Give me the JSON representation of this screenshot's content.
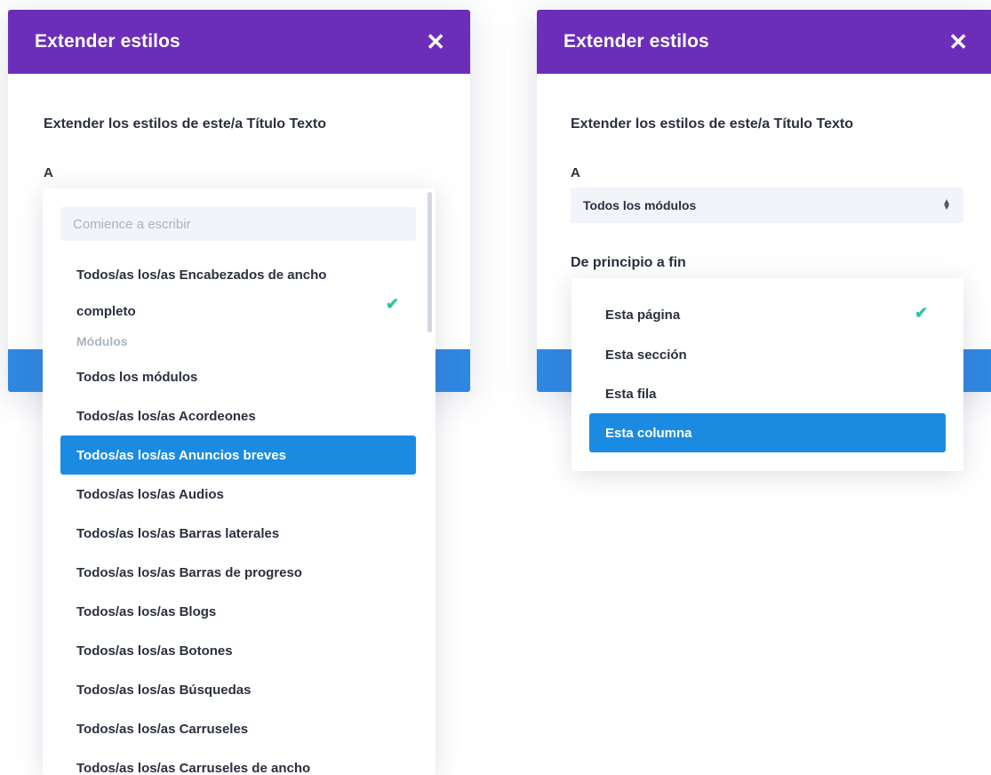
{
  "left_modal": {
    "title": "Extender estilos",
    "close_icon": "close-icon",
    "description": "Extender los estilos de este/a Título Texto",
    "to_label": "A"
  },
  "left_dropdown": {
    "search_placeholder": "Comience a escribir",
    "first_option": "Todos/as los/as Encabezados de ancho completo",
    "group_label": "Módulos",
    "options": [
      "Todos los módulos",
      "Todos/as los/as Acordeones",
      "Todos/as los/as Anuncios breves",
      "Todos/as los/as Audios",
      "Todos/as los/as Barras laterales",
      "Todos/as los/as Barras de progreso",
      "Todos/as los/as Blogs",
      "Todos/as los/as Botones",
      "Todos/as los/as Búsquedas",
      "Todos/as los/as Carruseles",
      "Todos/as los/as Carruseles de ancho"
    ],
    "selected_check": "check-icon",
    "highlighted_option": "Todos/as los/as Anuncios breves"
  },
  "right_modal": {
    "title": "Extender estilos",
    "close_icon": "close-icon",
    "description": "Extender los estilos de este/a Título Texto",
    "to_label": "A",
    "select_value": "Todos los módulos",
    "range_label": "De principio a fin"
  },
  "right_dropdown": {
    "options": [
      "Esta página",
      "Esta sección",
      "Esta fila",
      "Esta columna"
    ],
    "checked_option": "Esta página",
    "highlighted_option": "Esta columna"
  },
  "colors": {
    "header": "#6c2eb9",
    "footer": "#2e87e0",
    "highlight": "#1b8be2",
    "check": "#2cc2a3"
  }
}
